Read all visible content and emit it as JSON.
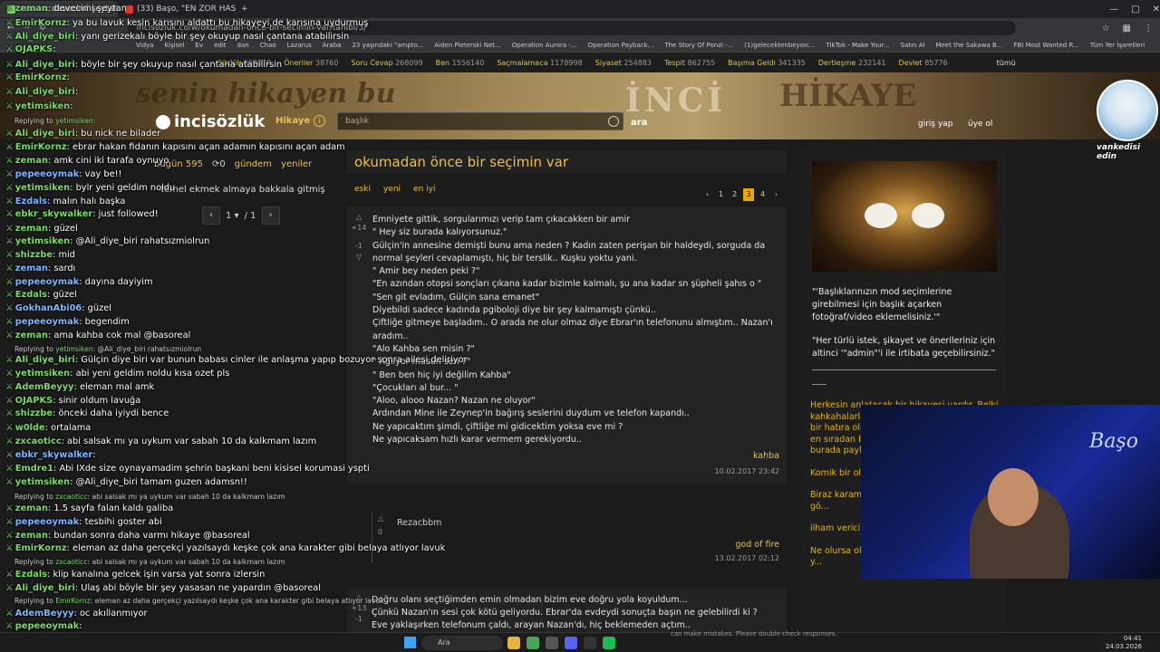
{
  "browser": {
    "tabs": [
      "zeman: devecimi şeytan",
      "(33) Başo, \"EN ZOR HASTAM K..."
    ],
    "url": "incisozluk.co/w/okumadan-once-bir-secimin-var/tahibi/3/",
    "bookmarks": [
      "Vidya",
      "Kişisel",
      "Ev",
      "edit",
      "dan",
      "Chao",
      "Lazarus",
      "Araba",
      "23 yaşındaki \"ampto...",
      "Aiden Pleterski Net...",
      "Operation Aurora -...",
      "Operation Payback...",
      "The Story Of Ponzi -...",
      "(1)gelecektenbeyoic...",
      "TikTok - Make Your...",
      "Satın Al",
      "Meet the Sakawa B...",
      "FBI Most Wanted R...",
      "Tüm Yer İşaretleri"
    ]
  },
  "categories": [
    {
      "name": "Sözlük",
      "count": "804078"
    },
    {
      "name": "Öneriler",
      "count": "38760"
    },
    {
      "name": "Soru Cevap",
      "count": "268099"
    },
    {
      "name": "Ben",
      "count": "1556140"
    },
    {
      "name": "Saçmalamaca",
      "count": "1178998"
    },
    {
      "name": "Siyaset",
      "count": "254883"
    },
    {
      "name": "Tespit",
      "count": "862755"
    },
    {
      "name": "Başıma Geldi",
      "count": "341335"
    },
    {
      "name": "Dertleşme",
      "count": "232141"
    },
    {
      "name": "Devlet",
      "count": "85776"
    }
  ],
  "categories_all": "tümü",
  "banner": {
    "left": "senin hikayen bu",
    "center": "İNCİ",
    "right": "HİKAYE"
  },
  "header": {
    "logo": "incisözlük",
    "section": "Hikaye",
    "search_placeholder": "başlık",
    "search_button": "ara",
    "login": "giriş yap",
    "signup": "üye ol"
  },
  "subnav": {
    "today": "bugün",
    "today_count": "595",
    "refresh": "0",
    "agenda": "gündem",
    "new": "yeniler"
  },
  "left_topic": "temel ekmek almaya bakkala gitmiş",
  "left_pager": {
    "page": "1",
    "total": "/ 1"
  },
  "topic": {
    "title": "okumadan önce bir seçimin var",
    "sorts": [
      "eski",
      "yeni",
      "en iyi"
    ],
    "pages": [
      "1",
      "2",
      "3",
      "4"
    ],
    "current_page": "3"
  },
  "entry1": {
    "up": "+14",
    "down": "-1",
    "text": "Emniyete gittik, sorgularımızı verip tam çıkacakken bir amir\n\" Hey siz burada kalıyorsunuz.\"\nGülçin'in annesine demişti bunu ama neden ? Kadın zaten perişan bir haldeydi, sorguda da normal şeyleri cevaplamıştı, hiç bir terslik.. Kuşku yoktu yani.\n\" Amir bey neden peki ?\"\n\"En azından otopsi sonçları çıkana kadar bizimle kalmalı, şu ana kadar sn şüpheli şahıs o \"\n\"Sen git evladım, Gülçin sana emanet\"\nDiyebildi sadece kadında pgiboloji diye bir şey kalmamıştı çünkü..\nÇiftliğe gitmeye başladım.. O arada ne olur olmaz diye Ebrar'ın telefonunu almıştım.. Nazan'ı aradım..\n\"Alo Kahba sen misin ?\"\n\" Ağlıyor musun sen ?\"\n\" Ben ben hiç iyi değilim Kahba\"\n\"Çocukları al bur... \"\n\"Aloo, alooo Nazan? Nazan ne oluyor\"\nArdından Mine ile Zeynep'in bağırış seslerini duydum ve telefon kapandı..\nNe yapıcaktım şimdi, çiftliğe mi gidicektim yoksa eve mi ?\nNe yapıcaksam hızlı karar vermem gerekiyordu..",
    "author": "kahba",
    "date": "10.02.2017 23:42"
  },
  "reply": {
    "vote": "0",
    "name": "Rezacbbm",
    "author": "god of fire",
    "date": "13.02.2017 02:12"
  },
  "entry2": {
    "up": "+13",
    "down": "-1",
    "text": "Doğru olanı seçtiğimden emin olmadan bizim eve doğru yola koyuldum...\nÇünkü Nazan'ın sesi çok kötü geliyordu. Ebrar'da evdeydi sonuçta başın ne gelebilirdi ki ?\nEve yaklaşırken telefonum çaldı, arayan Nazan'dı, hiç beklemeden açtım.."
  },
  "sidebar": {
    "notice1": "\"'Başlıklarınızın mod seçimlerine girebilmesi için başlık açarken fotoğraf/video eklemelisiniz.'\"",
    "notice2": "\"Her türlü istek, şikayet ve önerileriniz için altinci '\"admin\"'i ile irtibata geçebilirsiniz.\"",
    "y1": "Herkesin anlatacak bir hikayesi vardır. Belki kahkahalarla gülebilir bir, belki belki burkan bir hatıra olabilir, seni sonrası savurduğunu, en sıradan bir işe da sıradan olursa olsun burada paylaşabilirsin.",
    "y2": "Komik bir ola... Bizi gülümset...",
    "y3": "Biraz karamsa... Kendi duygul... olmadığını gö...",
    "y4": "ilham verici b... Hikayen başk...",
    "y5": "Ne olursa ols... var. Paylaş çü... dünyasında y..."
  },
  "chat_top": [
    {
      "user": "zeman",
      "text": "devecimi şeytan"
    },
    {
      "user": "EmirKornz",
      "text": "ya bu lavuk kesin karısını aldattı bu hikayeyi de karısına uydurmuş"
    },
    {
      "user": "Ali_diye_biri",
      "text": "yanı gerizekalı böyle bir şey okuyup nasıl çantana atabilirsin"
    },
    {
      "user": "OJAPKS",
      "text": ""
    },
    {
      "user": "Ali_diye_biri",
      "text": "böyle bir şey okuyup nasıl çantana atabilirsin"
    },
    {
      "user": "EmirKornz",
      "text": ""
    },
    {
      "user": "Ali_diye_biri",
      "text": ""
    },
    {
      "user": "yetimsiken",
      "text": ""
    }
  ],
  "chat": [
    {
      "user": "Ali_diye_biri",
      "text": "bu nick ne bilader"
    },
    {
      "user": "EmirKornz",
      "text": "ebrar hakan fidanın kapısını açan adamın kapısını açan adam"
    },
    {
      "user": "zeman",
      "text": "amk cini iki tarafa oynuyo"
    },
    {
      "user": "pepeeoymak",
      "text": "vay be!!"
    },
    {
      "user": "yetimsiken",
      "text": "bylr yeni geldim noldu"
    },
    {
      "user": "Ezdals",
      "text": "malın halı başka"
    },
    {
      "user": "ebkr_skywalker",
      "text": "just followed!"
    },
    {
      "user": "zeman",
      "text": "güzel"
    },
    {
      "user": "yetimsiken",
      "text": "@Ali_diye_biri rahatsızmiolrun"
    },
    {
      "user": "shizzbe",
      "text": "mid"
    },
    {
      "user": "zeman",
      "text": "sardı"
    },
    {
      "user": "pepeeoymak",
      "text": "dayına dayiyim"
    },
    {
      "user": "Ezdals",
      "text": "güzel"
    },
    {
      "user": "GokhanAbi06",
      "text": "güzel"
    },
    {
      "user": "pepeeoymak",
      "text": "begendim"
    },
    {
      "user": "zeman",
      "text": "ama kahba cok mal @basoreal"
    },
    {
      "user": "Ali_diye_biri",
      "text": "Gülçin diye biri var bunun babası cinler ile anlaşma yapıp bozuyor sonra ailesi deliriyor"
    },
    {
      "user": "yetimsiken",
      "text": "abi yeni geldim noldu kısa ozet pls"
    },
    {
      "user": "AdemBeyyy",
      "text": "eleman mal amk"
    },
    {
      "user": "OJAPKS",
      "text": "sinir oldum lavuğa"
    },
    {
      "user": "shizzbe",
      "text": "önceki daha iyiydi bence"
    },
    {
      "user": "w0lde",
      "text": "ortalama"
    },
    {
      "user": "zxcaoticc",
      "text": "abi salsak mı ya uykum var sabah 10 da kalkmam lazım"
    },
    {
      "user": "ebkr_skywalker",
      "text": ""
    },
    {
      "user": "Emdre1",
      "text": "Abi IXde size oynayamadim şehrin başkani beni kisisel korumasi yspti"
    },
    {
      "user": "yetimsiken",
      "text": "@Ali_diye_biri tamam guzen adamsn!!"
    },
    {
      "user": "zeman",
      "text": "1.5 sayfa falan kaldı galiba"
    },
    {
      "user": "pepeeoymak",
      "text": "tesbihi goster abi"
    },
    {
      "user": "zeman",
      "text": "bundan sonra daha varmı hikaye @basoreal"
    },
    {
      "user": "EmirKornz",
      "text": "eleman az daha gerçekçi yazılsaydı keşke çok ana karakter gibi belaya atlıyor lavuk"
    },
    {
      "user": "Ezdals",
      "text": "klip kanalına gelcek işin varsa yat sonra izlersin"
    },
    {
      "user": "Ali_diye_biri",
      "text": "Ulaş abi böyle bir şey yasasan ne yapardın @basoreal"
    },
    {
      "user": "AdemBeyyy",
      "text": "oc akıllanmıyor"
    },
    {
      "user": "pepeeoymak",
      "text": ""
    },
    {
      "user": "yetimsiken",
      "text": ""
    }
  ],
  "chat_replies": [
    {
      "label": "Replying to",
      "user": "yetimsiken",
      "text": ""
    },
    {
      "label": "Replying to",
      "user": "yetimsiken",
      "text": "@Ali_diye_biri rahatsızmiolrun"
    },
    {
      "label": "Replying to",
      "user": "zxcaoticc",
      "text": "abi salsak mı ya uykum var sabah 10 da kalkmam lazım"
    },
    {
      "label": "Replying to",
      "user": "zxcaoticc",
      "text": "abi salsak mı ya uykum var sabah 10 da kalkmam lazım"
    },
    {
      "label": "Replying to",
      "user": "EmirKornz",
      "text": "eleman az daha gerçekçi yazılsaydı keşke çok ana karakter gibi belaya atlıyor lavuk"
    }
  ],
  "ebkr_tag": "(ebkr-skywalker)",
  "avatar_caption": "vankedisi edin",
  "cam_logo": "Başo",
  "taskbar": {
    "search": "Ara",
    "time": "04:41",
    "date": "24.03.2026"
  },
  "hint": "can make mistakes. Please double-check responses."
}
